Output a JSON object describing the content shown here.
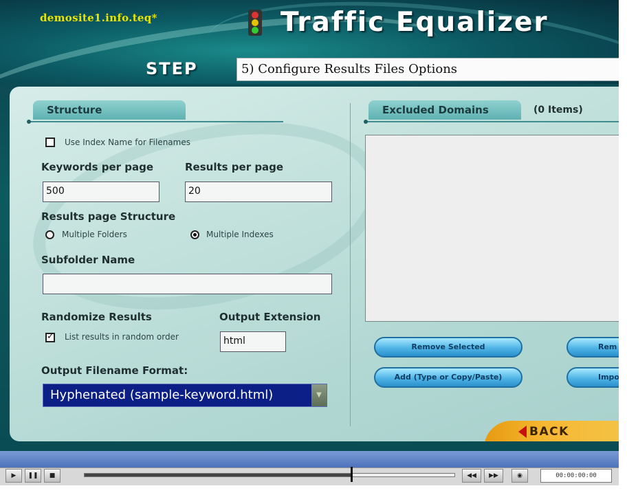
{
  "header": {
    "site": "demosite1.info.teq*",
    "title": "Traffic Equalizer",
    "step_label": "STEP",
    "step_text": "5) Configure Results Files Options"
  },
  "structure": {
    "tab_label": "Structure",
    "use_index_name_label": "Use Index Name for Filenames",
    "use_index_name_checked": false,
    "keywords_per_page_label": "Keywords per page",
    "keywords_per_page_value": "500",
    "results_per_page_label": "Results per page",
    "results_per_page_value": "20",
    "results_page_structure_label": "Results page Structure",
    "option_multiple_folders": "Multiple Folders",
    "option_multiple_indexes": "Multiple Indexes",
    "selected_option": "Multiple Indexes",
    "subfolder_name_label": "Subfolder Name",
    "subfolder_name_value": "",
    "randomize_results_label": "Randomize Results",
    "list_random_label": "List results in random order",
    "list_random_checked": true,
    "output_extension_label": "Output Extension",
    "output_extension_value": "html",
    "output_filename_format_label": "Output Filename Format:",
    "output_filename_format_value": "Hyphenated (sample-keyword.html)"
  },
  "excluded": {
    "tab_label": "Excluded Domains",
    "count_label": "(0 Items)",
    "items": [],
    "remove_selected_label": "Remove Selected",
    "remove_cut_label": "Rem",
    "add_label": "Add (Type or Copy/Paste)",
    "import_cut_label": "Impo"
  },
  "back_label": "BACK",
  "player": {
    "progress": 0.72,
    "timecode": "00:00:00:00",
    "play_icon": "▶",
    "pause_icon": "❚❚",
    "stop_icon": "■",
    "rewind_icon": "◀◀",
    "forward_icon": "▶▶",
    "volume_icon": "◉"
  },
  "colors": {
    "site_text": "#e9e400",
    "select_bg": "#0c1f86",
    "button_blue": "#4fb4e6",
    "back_orange": "#f6b833"
  }
}
